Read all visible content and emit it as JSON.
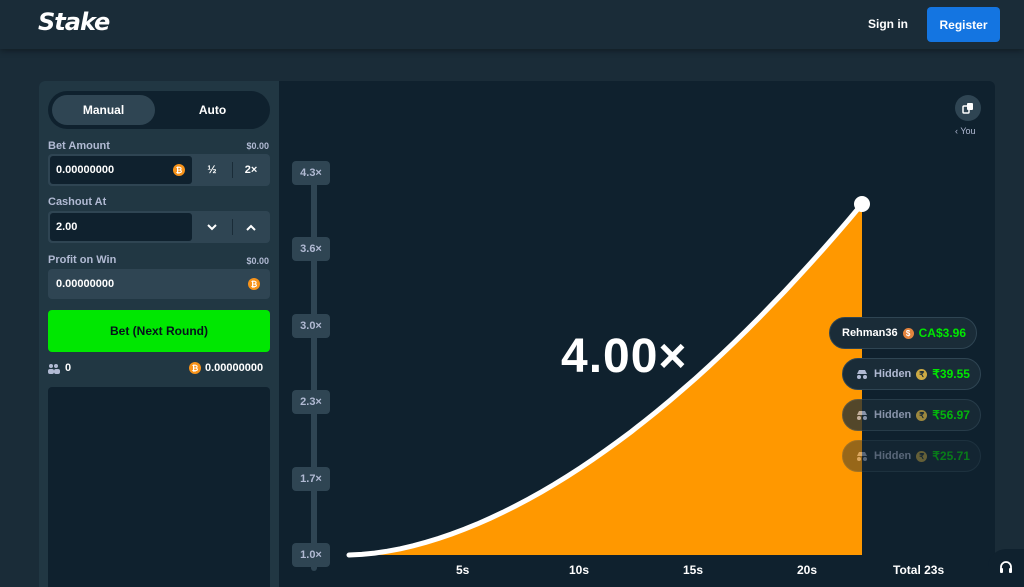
{
  "header": {
    "logo": "Stake",
    "signin": "Sign in",
    "register": "Register"
  },
  "sidebar": {
    "tabs": {
      "manual": "Manual",
      "auto": "Auto"
    },
    "bet_amount": {
      "label": "Bet Amount",
      "fiat": "$0.00",
      "value": "0.00000000",
      "half": "½",
      "double": "2×"
    },
    "cashout": {
      "label": "Cashout At",
      "value": "2.00"
    },
    "profit": {
      "label": "Profit on Win",
      "fiat": "$0.00",
      "value": "0.00000000"
    },
    "bet_button": "Bet (Next Round)",
    "stats": {
      "players": "0",
      "total": "0.00000000"
    }
  },
  "game": {
    "multiplier": "4.00×",
    "you_label": "‹ You",
    "y_ticks": [
      "4.3×",
      "3.6×",
      "3.0×",
      "2.3×",
      "1.7×",
      "1.0×"
    ],
    "x_ticks": [
      "5s",
      "10s",
      "15s",
      "20s"
    ],
    "total": "Total 23s",
    "curve": {
      "start_x": 0,
      "end_x": 22.5,
      "start_y": 1.0,
      "end_y": 4.0
    },
    "curve_color": "#ff9800",
    "cashouts": [
      {
        "name": "Rehman36",
        "currency": "$",
        "amount": "CA$3.96",
        "hidden": false
      },
      {
        "name": "Hidden",
        "currency": "₹",
        "amount": "₹39.55",
        "hidden": true,
        "opacity": 1
      },
      {
        "name": "Hidden",
        "currency": "₹",
        "amount": "₹56.97",
        "hidden": true,
        "opacity": 0.75
      },
      {
        "name": "Hidden",
        "currency": "₹",
        "amount": "₹25.71",
        "hidden": true,
        "opacity": 0.45
      }
    ]
  },
  "colors": {
    "accent_green": "#00e701",
    "brand_blue": "#1475e1",
    "orange": "#ff9800"
  }
}
